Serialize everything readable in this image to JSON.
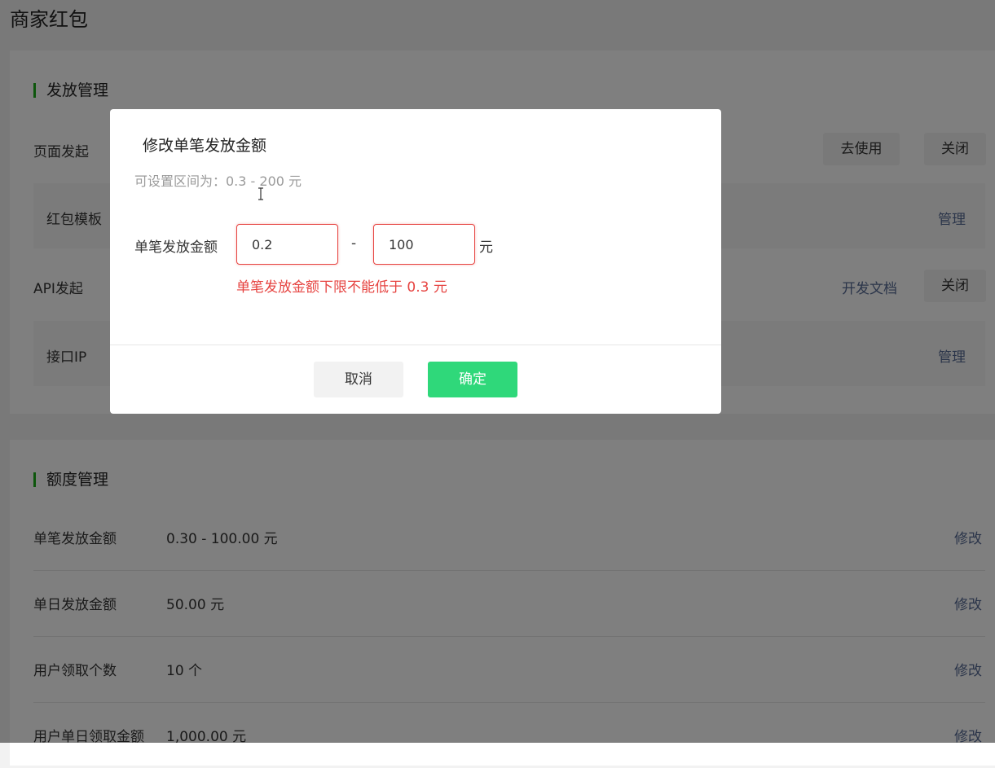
{
  "page": {
    "title": "商家红包"
  },
  "dispatch": {
    "title": "发放管理",
    "page_launch": {
      "label": "页面发起",
      "use_button": "去使用",
      "close_button": "关闭"
    },
    "template": {
      "label": "红包模板",
      "manage_link": "管理"
    },
    "api_launch": {
      "label": "API发起",
      "docs_link": "开发文档",
      "close_button": "关闭"
    },
    "api_ip": {
      "label": "接口IP",
      "manage_link": "管理"
    }
  },
  "quota": {
    "title": "额度管理",
    "rows": [
      {
        "label": "单笔发放金额",
        "value": "0.30 - 100.00 元",
        "action": "修改"
      },
      {
        "label": "单日发放金额",
        "value": "50.00 元",
        "action": "修改"
      },
      {
        "label": "用户领取个数",
        "value": "10 个",
        "action": "修改"
      },
      {
        "label": "用户单日领取金额",
        "value": "1,000.00 元",
        "action": "修改"
      }
    ]
  },
  "dialog": {
    "title": "修改单笔发放金额",
    "hint": "可设置区间为：0.3 - 200 元",
    "field_label": "单笔发放金额",
    "min_value": "0.2",
    "max_value": "100",
    "separator": "-",
    "unit": "元",
    "error": "单笔发放金额下限不能低于 0.3 元",
    "cancel_label": "取消",
    "confirm_label": "确定"
  },
  "colors": {
    "accent_green": "#1aad19",
    "confirm_green": "#2fd87a",
    "error_red": "#e64340",
    "link_blue": "#576b95"
  }
}
